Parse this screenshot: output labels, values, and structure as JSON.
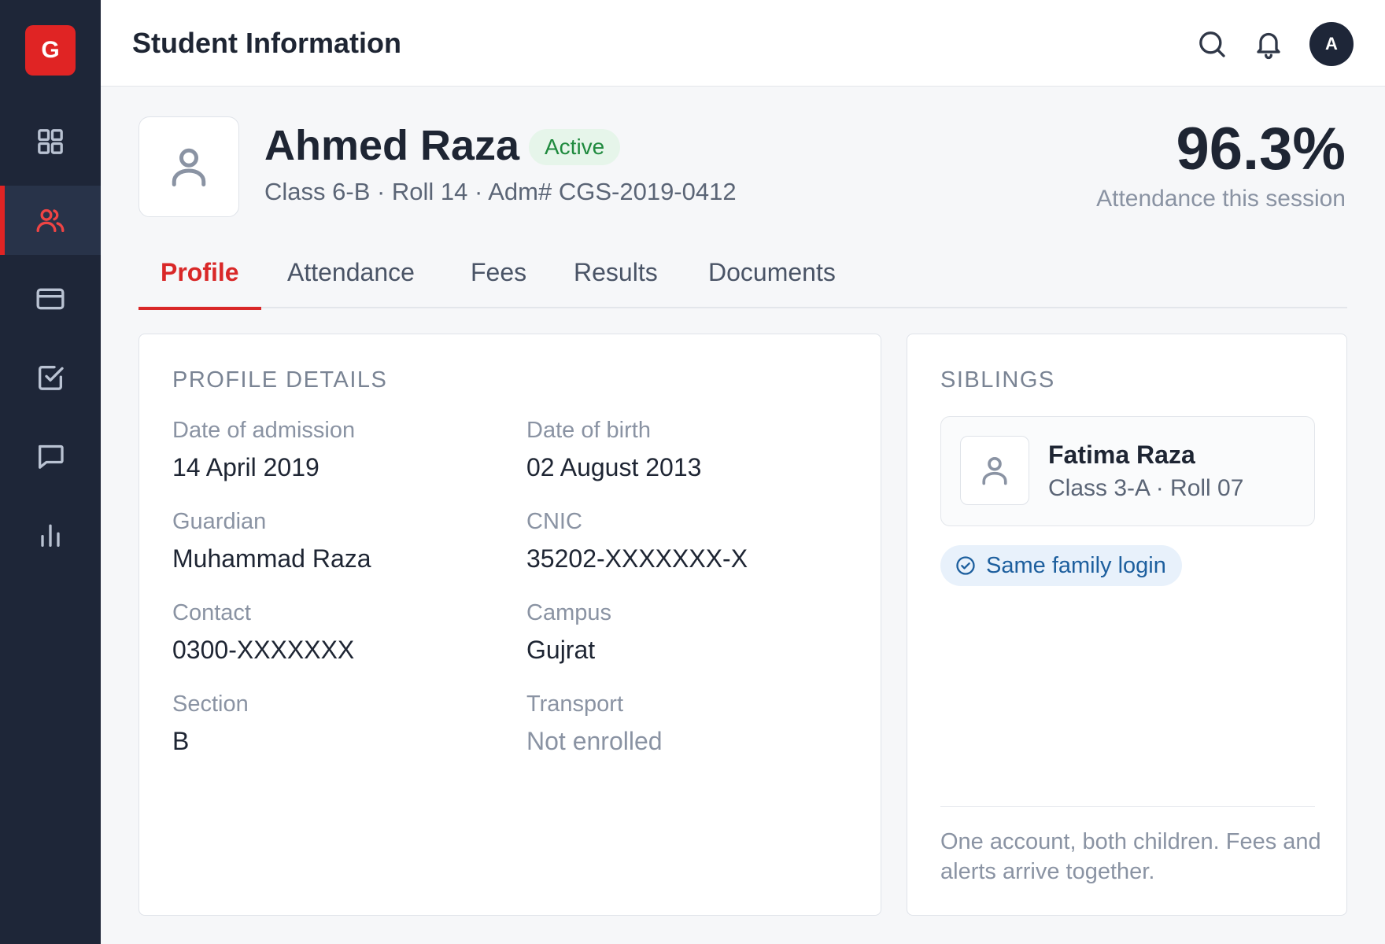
{
  "app": {
    "logo_letter": "G"
  },
  "sidebar": {
    "items": [
      {
        "icon": "grid-icon",
        "active": false
      },
      {
        "icon": "users-icon",
        "active": true
      },
      {
        "icon": "credit-card-icon",
        "active": false
      },
      {
        "icon": "check-square-icon",
        "active": false
      },
      {
        "icon": "message-icon",
        "active": false
      },
      {
        "icon": "bar-chart-icon",
        "active": false
      }
    ]
  },
  "header": {
    "title": "Student Information",
    "icons": [
      "search-icon",
      "bell-icon"
    ],
    "avatar_initial": "A"
  },
  "student": {
    "name": "Ahmed Raza",
    "status": "Active",
    "meta": "Class 6-B · Roll 14 · Adm# CGS-2019-0412",
    "attendance_value": "96.3%",
    "attendance_label": "Attendance this session"
  },
  "tabs": [
    {
      "label": "Profile",
      "active": true
    },
    {
      "label": "Attendance",
      "active": false
    },
    {
      "label": "Fees",
      "active": false
    },
    {
      "label": "Results",
      "active": false
    },
    {
      "label": "Documents",
      "active": false
    }
  ],
  "profile": {
    "title": "PROFILE DETAILS",
    "fields": [
      {
        "label": "Date of admission",
        "value": "14 April 2019"
      },
      {
        "label": "Date of birth",
        "value": "02 August 2013"
      },
      {
        "label": "Guardian",
        "value": "Muhammad Raza"
      },
      {
        "label": "CNIC",
        "value": "35202-XXXXXXX-X"
      },
      {
        "label": "Contact",
        "value": "0300-XXXXXXX"
      },
      {
        "label": "Campus",
        "value": "Gujrat"
      },
      {
        "label": "Section",
        "value": "B"
      },
      {
        "label": "Transport",
        "value": "Not enrolled"
      }
    ]
  },
  "siblings": {
    "title": "SIBLINGS",
    "items": [
      {
        "name": "Fatima Raza",
        "meta": "Class 3-A · Roll 07"
      }
    ],
    "family_chip": "Same family login",
    "note": "One account, both children. Fees and alerts arrive together."
  },
  "colors": {
    "brand": "#e02424",
    "sidebar_bg": "#1e2638",
    "active_badge_bg": "#e6f5ea",
    "active_badge_text": "#1f8a3e",
    "chip_bg": "#e8f1fb",
    "chip_text": "#1d5f9e"
  }
}
